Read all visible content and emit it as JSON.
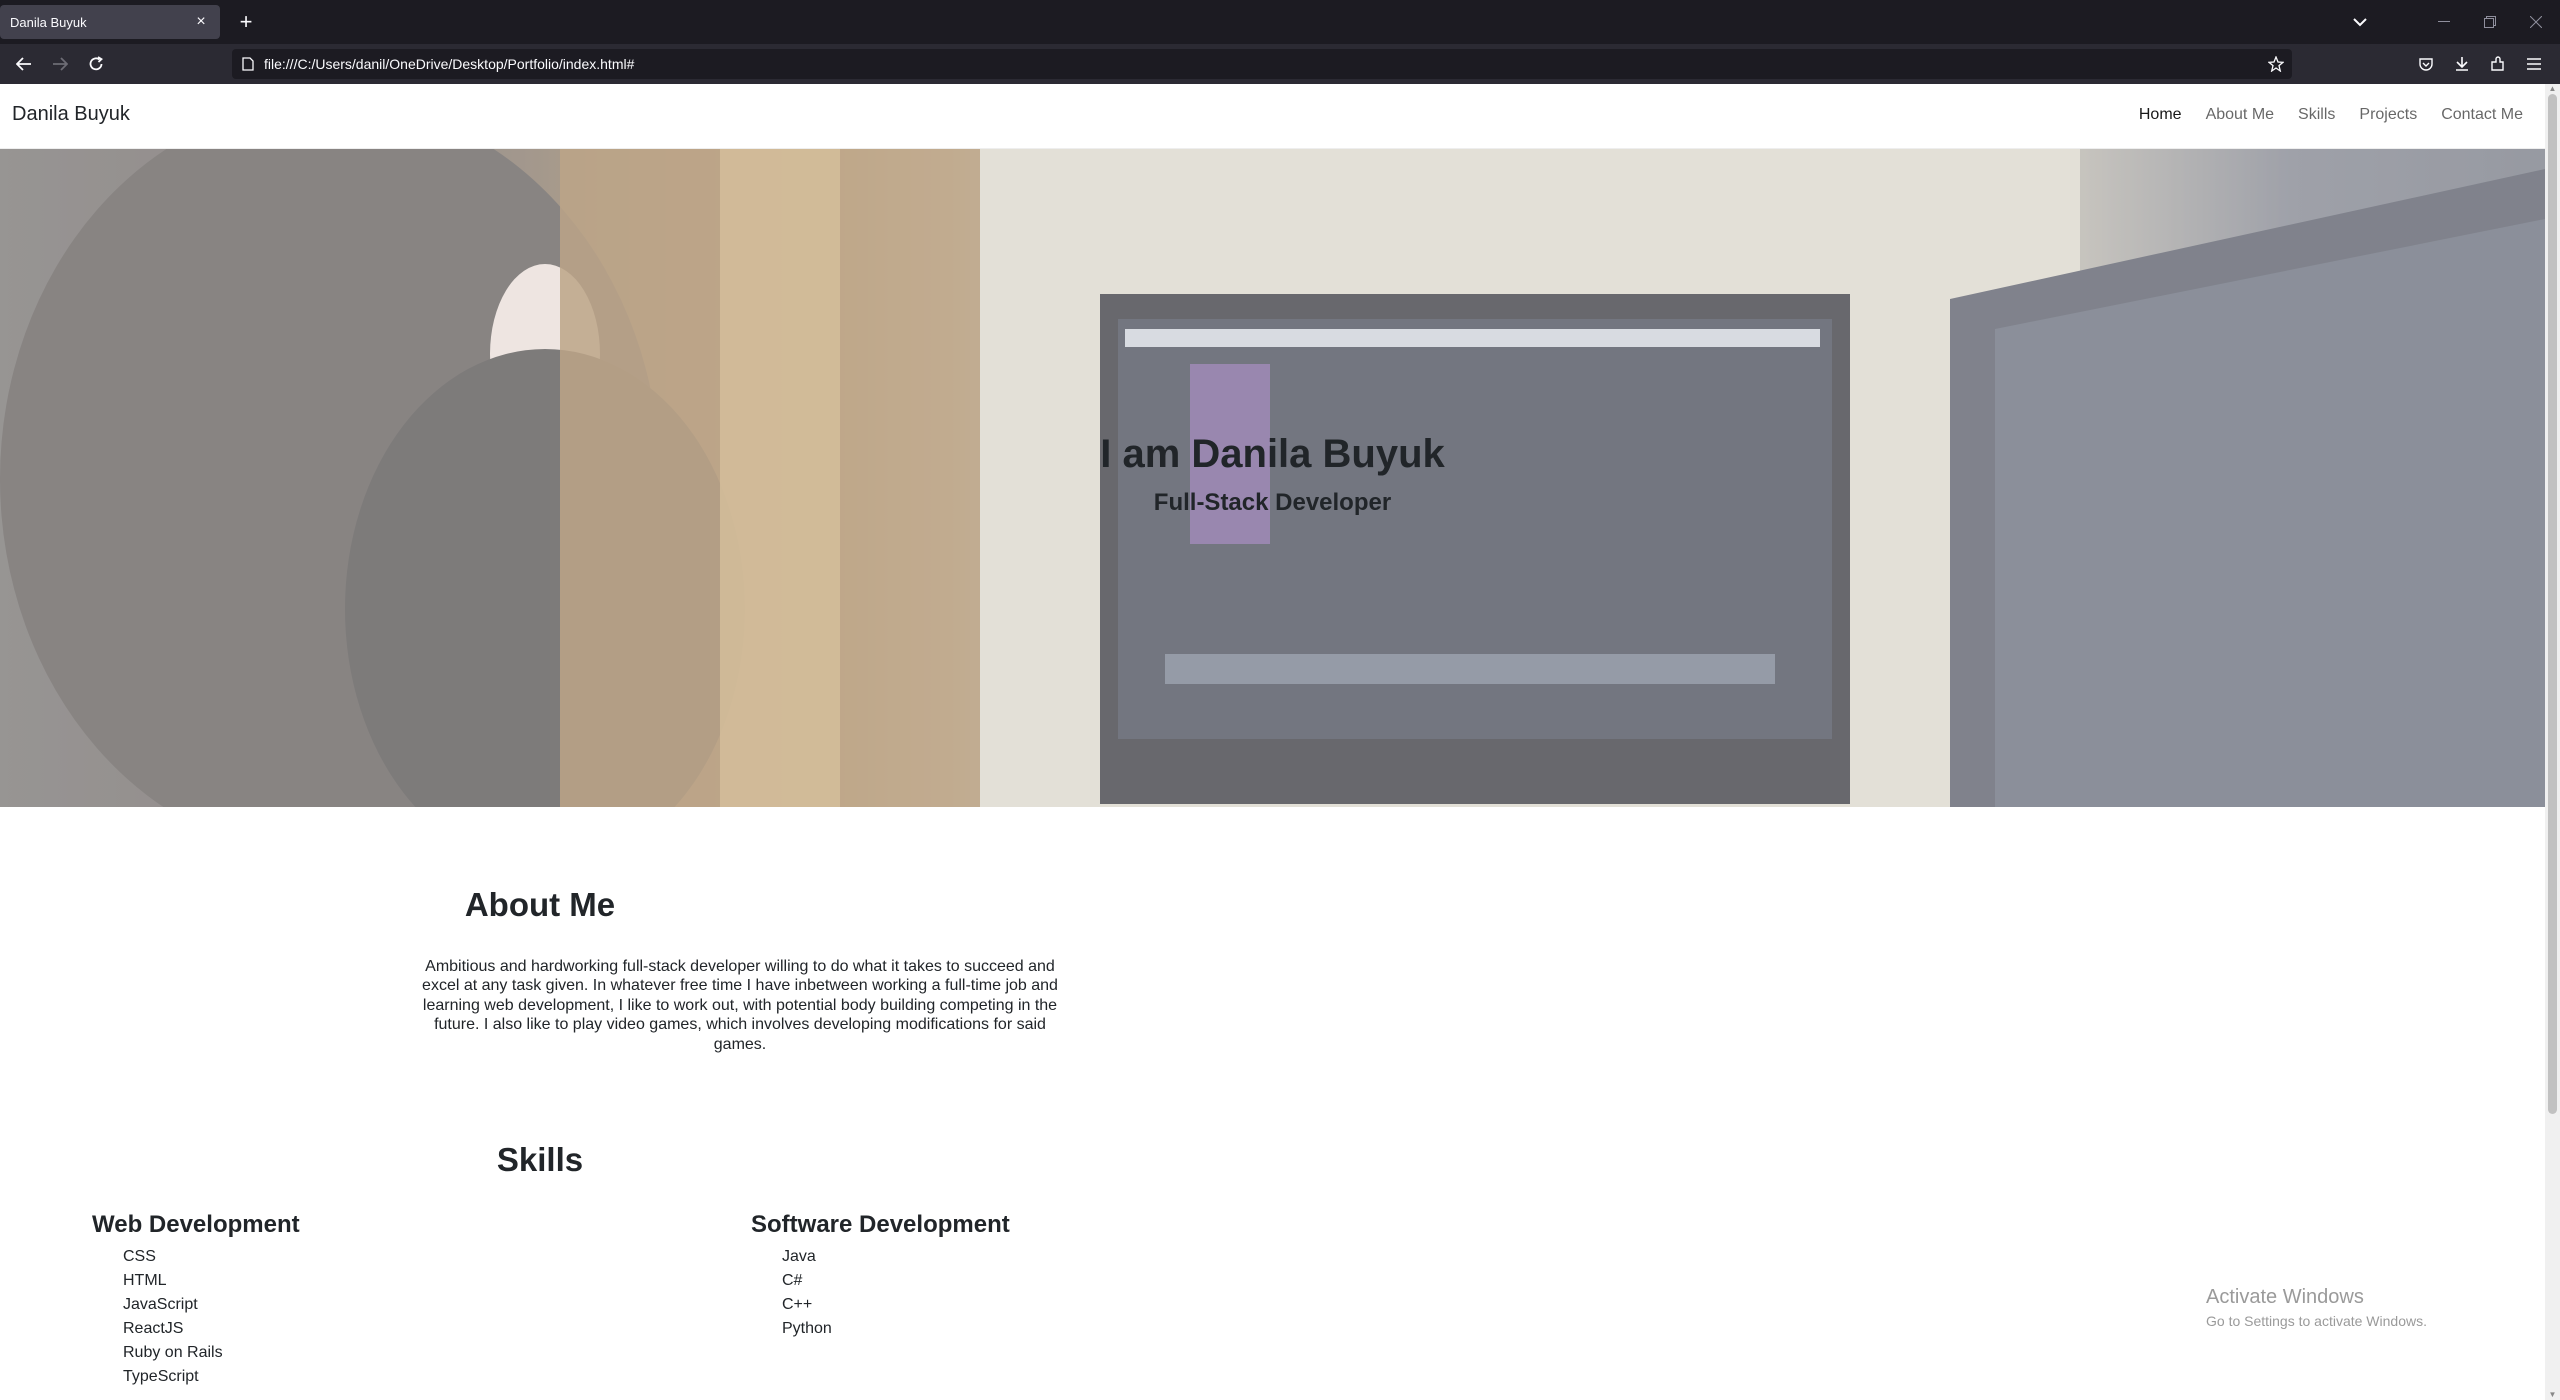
{
  "browser": {
    "tab_title": "Danila Buyuk",
    "tab_close": "×",
    "new_tab": "+",
    "url": "file:///C:/Users/danil/OneDrive/Desktop/Portfolio/index.html#"
  },
  "site": {
    "brand": "Danila Buyuk",
    "nav": [
      {
        "label": "Home",
        "active": true
      },
      {
        "label": "About Me"
      },
      {
        "label": "Skills"
      },
      {
        "label": "Projects"
      },
      {
        "label": "Contact Me"
      }
    ],
    "hero": {
      "title": "I am Danila Buyuk",
      "subtitle": "Full-Stack Developer"
    },
    "about": {
      "title": "About Me",
      "text": "Ambitious and hardworking full-stack developer willing to do what it takes to succeed and excel at any task given. In whatever free time I have inbetween working a full-time job and learning web development, I like to work out, with potential body building competing in the future. I also like to play video games, which involves developing modifications for said games."
    },
    "skills": {
      "title": "Skills",
      "web": {
        "title": "Web Development",
        "items": [
          "CSS",
          "HTML",
          "JavaScript",
          "ReactJS",
          "Ruby on Rails",
          "TypeScript"
        ]
      },
      "software": {
        "title": "Software Development",
        "items": [
          "Java",
          "C#",
          "C++",
          "Python"
        ]
      }
    }
  },
  "windows_watermark": {
    "title": "Activate Windows",
    "subtitle": "Go to Settings to activate Windows."
  }
}
